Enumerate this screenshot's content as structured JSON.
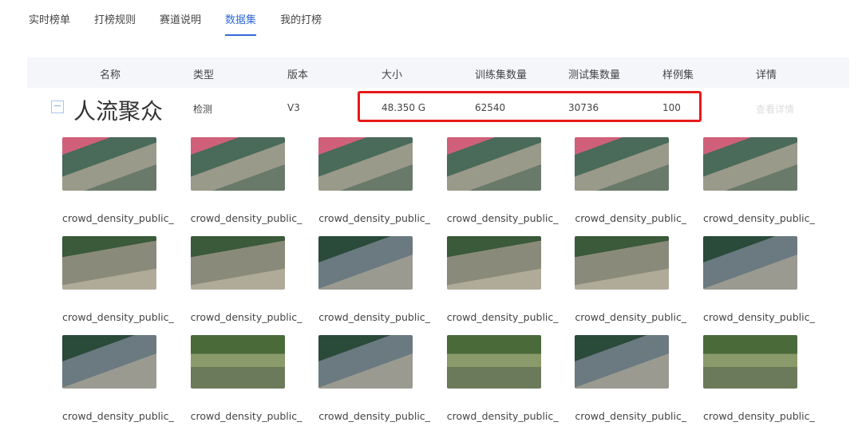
{
  "tabs": [
    "实时榜单",
    "打榜规则",
    "赛道说明",
    "数据集",
    "我的打榜"
  ],
  "active_tab": 3,
  "table": {
    "headers": [
      "名称",
      "类型",
      "版本",
      "大小",
      "训练集数量",
      "测试集数量",
      "样例集",
      "详情"
    ],
    "row": {
      "collapse_symbol": "−",
      "name": "人流聚众",
      "type": "检测",
      "version": "V3",
      "size": "48.350 G",
      "train_count": "62540",
      "test_count": "30736",
      "samples": "100",
      "details": "查看详情"
    }
  },
  "images": [
    {
      "caption": "crowd_density_public_..."
    },
    {
      "caption": "crowd_density_public_..."
    },
    {
      "caption": "crowd_density_public_..."
    },
    {
      "caption": "crowd_density_public_..."
    },
    {
      "caption": "crowd_density_public_..."
    },
    {
      "caption": "crowd_density_public_..."
    },
    {
      "caption": "crowd_density_public_..."
    },
    {
      "caption": "crowd_density_public_..."
    },
    {
      "caption": "crowd_density_public_..."
    },
    {
      "caption": "crowd_density_public_..."
    },
    {
      "caption": "crowd_density_public_..."
    },
    {
      "caption": "crowd_density_public_..."
    },
    {
      "caption": "crowd_density_public_..."
    },
    {
      "caption": "crowd_density_public_..."
    },
    {
      "caption": "crowd_density_public_..."
    },
    {
      "caption": "crowd_density_public_..."
    },
    {
      "caption": "crowd_density_public_..."
    },
    {
      "caption": "crowd_density_public_..."
    }
  ],
  "colors": {
    "accent": "#2f6bd6",
    "highlight": "#e81a1a"
  }
}
